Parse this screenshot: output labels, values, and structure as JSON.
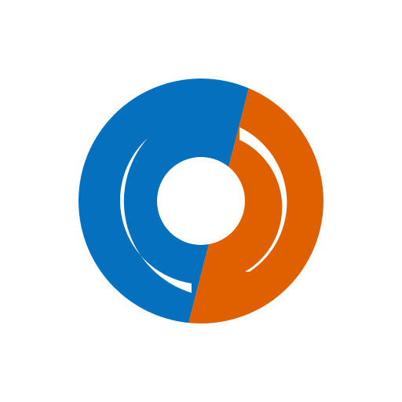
{
  "logo": {
    "name": "circular-split-logo",
    "colors": {
      "background": "#ffffff",
      "blue": "#0570BD",
      "orange": "#E06000"
    }
  }
}
